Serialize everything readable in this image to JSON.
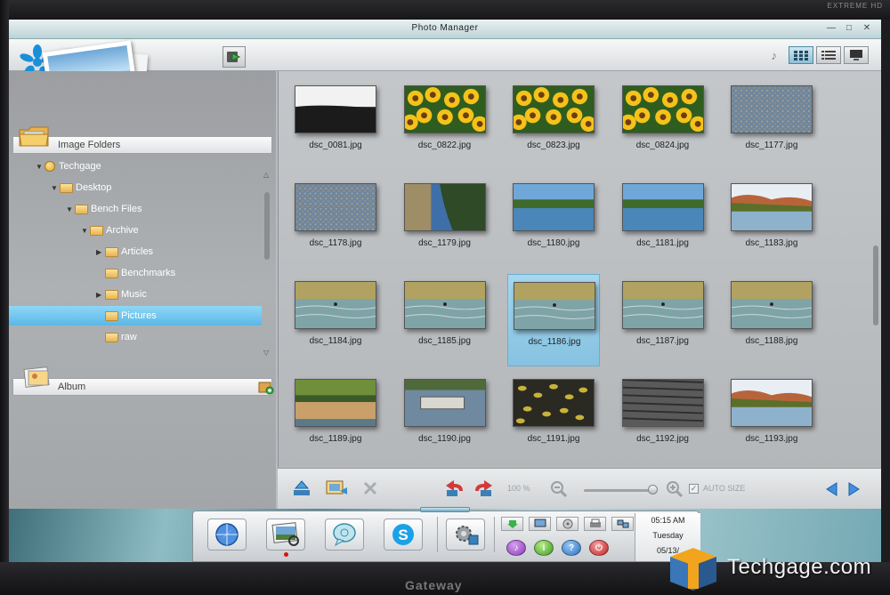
{
  "window": {
    "title": "Photo Manager",
    "controls": [
      "—",
      "□",
      "✕"
    ]
  },
  "toolbar": {
    "views": [
      "thumbnail-view",
      "list-view",
      "slideshow-view"
    ],
    "active_view": "thumbnail-view"
  },
  "left_panel": {
    "image_folders_label": "Image Folders",
    "album_label": "Album",
    "tree": [
      {
        "label": "Techgage",
        "level": 0,
        "expanded": true,
        "type": "user"
      },
      {
        "label": "Desktop",
        "level": 1,
        "expanded": true,
        "type": "folder"
      },
      {
        "label": "Bench Files",
        "level": 2,
        "expanded": true,
        "type": "folder"
      },
      {
        "label": "Archive",
        "level": 3,
        "expanded": true,
        "type": "folder"
      },
      {
        "label": "Articles",
        "level": 4,
        "expanded": false,
        "has_children": true,
        "type": "folder"
      },
      {
        "label": "Benchmarks",
        "level": 4,
        "has_children": false,
        "type": "folder"
      },
      {
        "label": "Music",
        "level": 4,
        "expanded": false,
        "has_children": true,
        "type": "folder"
      },
      {
        "label": "Pictures",
        "level": 4,
        "has_children": false,
        "type": "folder",
        "selected": true
      },
      {
        "label": "raw",
        "level": 4,
        "has_children": false,
        "type": "folder"
      }
    ]
  },
  "thumbnails": [
    {
      "name": "dsc_0081.jpg",
      "scene": "dusk"
    },
    {
      "name": "dsc_0822.jpg",
      "scene": "sunflowers"
    },
    {
      "name": "dsc_0823.jpg",
      "scene": "sunflowers"
    },
    {
      "name": "dsc_0824.jpg",
      "scene": "sunflowers"
    },
    {
      "name": "dsc_1177.jpg",
      "scene": "gravel"
    },
    {
      "name": "dsc_1178.jpg",
      "scene": "gravel"
    },
    {
      "name": "dsc_1179.jpg",
      "scene": "reflection"
    },
    {
      "name": "dsc_1180.jpg",
      "scene": "lake"
    },
    {
      "name": "dsc_1181.jpg",
      "scene": "lake"
    },
    {
      "name": "dsc_1183.jpg",
      "scene": "autumn-lake"
    },
    {
      "name": "dsc_1184.jpg",
      "scene": "water"
    },
    {
      "name": "dsc_1185.jpg",
      "scene": "water"
    },
    {
      "name": "dsc_1186.jpg",
      "scene": "water",
      "selected": true
    },
    {
      "name": "dsc_1187.jpg",
      "scene": "water"
    },
    {
      "name": "dsc_1188.jpg",
      "scene": "water"
    },
    {
      "name": "dsc_1189.jpg",
      "scene": "marsh"
    },
    {
      "name": "dsc_1190.jpg",
      "scene": "dock"
    },
    {
      "name": "dsc_1191.jpg",
      "scene": "leaves"
    },
    {
      "name": "dsc_1192.jpg",
      "scene": "shingles"
    },
    {
      "name": "dsc_1193.jpg",
      "scene": "autumn-lake"
    }
  ],
  "bottom_bar": {
    "zoom": "100 %",
    "auto_size_label": "AUTO SIZE"
  },
  "taskbar": {
    "time": "05:15 AM",
    "day": "Tuesday",
    "date": "05/13/"
  },
  "watermark": {
    "text": "Techgage.com"
  },
  "bezel": {
    "brand": "Gateway",
    "tag": "EXTREME HD"
  },
  "colors": {
    "selection": "#5ab8e6",
    "accent": "#4f88a3",
    "star": "#1a8fd9"
  }
}
